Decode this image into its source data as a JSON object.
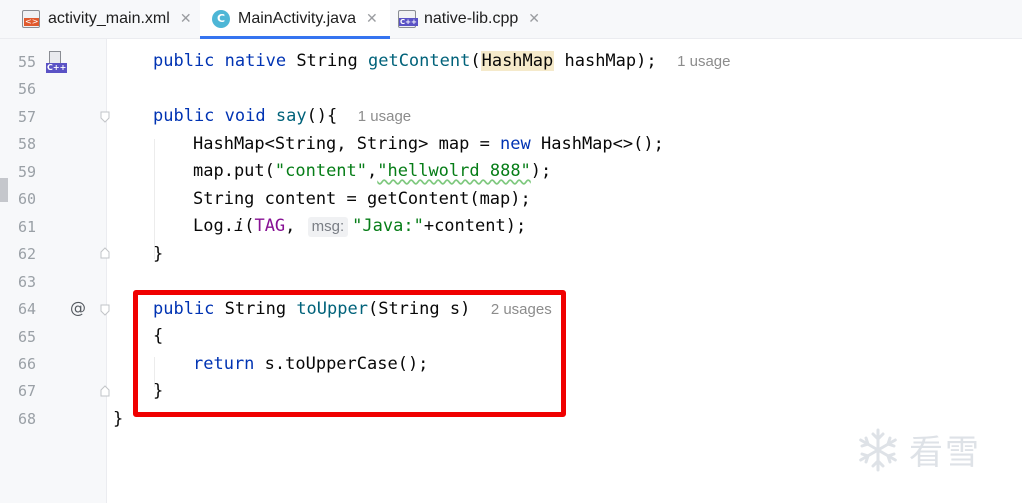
{
  "tabs": [
    {
      "label": "activity_main.xml",
      "icon": "xml-file-icon"
    },
    {
      "label": "MainActivity.java",
      "icon": "java-class-icon",
      "active": true,
      "icon_letter": "C"
    },
    {
      "label": "native-lib.cpp",
      "icon": "cpp-file-icon"
    }
  ],
  "gutter": {
    "line_numbers": [
      "55",
      "56",
      "57",
      "58",
      "59",
      "60",
      "61",
      "62",
      "63",
      "64",
      "65",
      "66",
      "67",
      "68"
    ],
    "native_icon_label": "C++",
    "override_marker": "@"
  },
  "code": {
    "l55": {
      "kw": "public native",
      "type": "String",
      "fn": "getContent",
      "open": "(",
      "hl": "HashMap",
      "rest": " hashMap);",
      "hint": "1 usage"
    },
    "l57": {
      "kw": "public void",
      "fn": "say",
      "rest": "(){",
      "hint": "1 usage"
    },
    "l58": {
      "a": "HashMap<String, String> map = ",
      "kw": "new",
      "b": " HashMap<>();"
    },
    "l59": {
      "a": "map.put(",
      "s1": "\"content\"",
      "comma": ",",
      "s2": "\"hellwolrd 888\"",
      "end": ");"
    },
    "l60": {
      "a": "String content = getContent(map);"
    },
    "l61": {
      "a": "Log.",
      "method": "i",
      "open": "(",
      "const": "TAG",
      "comma": ", ",
      "param_hint": "msg:",
      "str": "\"Java:\"",
      "end": "+content);"
    },
    "l62": {
      "a": "}"
    },
    "l64": {
      "kw": "public",
      "type": " String ",
      "fn": "toUpper",
      "rest": "(String s)",
      "hint": "2 usages"
    },
    "l65": {
      "a": "{"
    },
    "l66": {
      "kw": "return",
      "rest": " s.toUpperCase();"
    },
    "l67": {
      "a": "}"
    },
    "l68": {
      "a": "}"
    }
  },
  "highlight_box_color": "#f00000",
  "watermark": {
    "text": "看雪",
    "icon": "snowflake-icon"
  }
}
